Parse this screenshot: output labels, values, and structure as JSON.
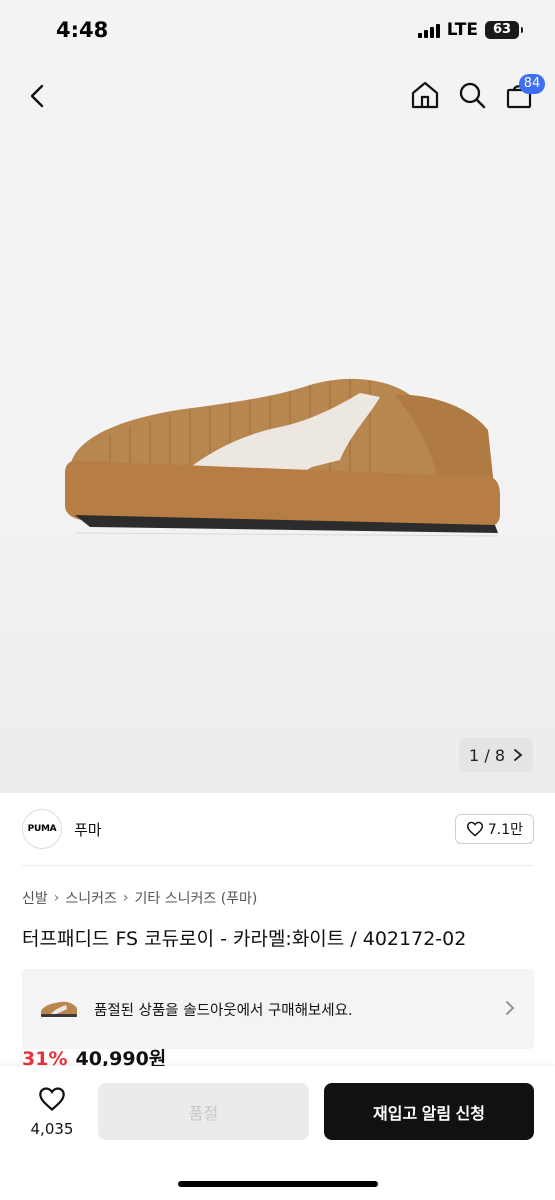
{
  "status_bar": {
    "time": "4:48",
    "network": "LTE",
    "battery": "63"
  },
  "nav": {
    "back_icon": "chevron-left-icon",
    "icons": [
      "home-icon",
      "search-icon",
      "shopping-bag-icon"
    ],
    "cart_badge": "84"
  },
  "gallery": {
    "current": "1",
    "separator": "/",
    "total": "8"
  },
  "brand": {
    "logo_text": "PUMA",
    "name": "푸마",
    "likes": "7.1만"
  },
  "breadcrumb": [
    "신발",
    "스니커즈",
    "기타 스니커즈 (푸마)"
  ],
  "product": {
    "title": "터프패디드 FS 코듀로이 - 카라멜:화이트 / 402172-02"
  },
  "soldout_banner": {
    "text": "품절된 상품을 솔드아웃에서 구매해보세요."
  },
  "price": {
    "discount": "31%",
    "amount": "40,990원"
  },
  "bottom_bar": {
    "wish_count": "4,035",
    "soldout_label": "품절",
    "restock_label": "재입고 알림 신청"
  },
  "colors": {
    "accent_blue": "#3d6ef3",
    "discount_red": "#e8323c",
    "primary_button": "#111111"
  }
}
